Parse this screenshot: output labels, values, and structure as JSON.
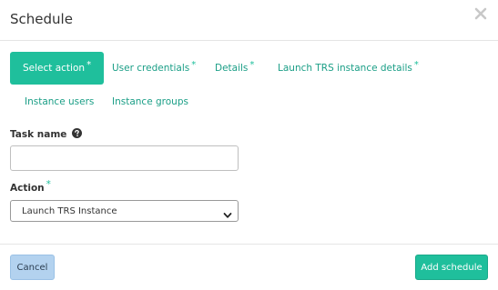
{
  "modal": {
    "title": "Schedule"
  },
  "tabs": [
    {
      "label": "Select action",
      "required_mark": "*",
      "active": true
    },
    {
      "label": "User credentials",
      "required_mark": "*",
      "active": false
    },
    {
      "label": "Details",
      "required_mark": "*",
      "active": false
    },
    {
      "label": "Launch TRS instance details",
      "required_mark": "*",
      "active": false
    },
    {
      "label": "Instance users",
      "required_mark": "",
      "active": false
    },
    {
      "label": "Instance groups",
      "required_mark": "",
      "active": false
    }
  ],
  "form": {
    "task_name": {
      "label": "Task name",
      "value": "",
      "placeholder": ""
    },
    "action": {
      "label": "Action",
      "required_mark": "*",
      "selected": "Launch TRS Instance"
    }
  },
  "footer": {
    "cancel_label": "Cancel",
    "add_label": "Add schedule"
  },
  "colors": {
    "accent": "#1fbf9c",
    "link": "#1a9e86",
    "cancel_bg": "#b3d2ef"
  },
  "icons": {
    "close": "close-icon",
    "help": "question-circle-icon",
    "dropdown": "chevron-down-icon"
  }
}
